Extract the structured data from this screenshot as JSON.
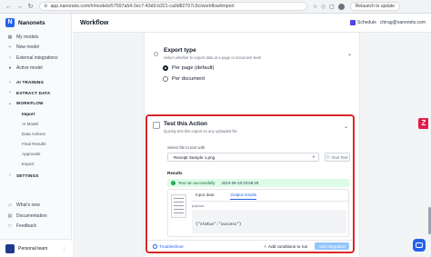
{
  "browser": {
    "url": "app.nanonets.com/#/models/57597a54-2ec7-43d3-b321-ca0d82707c3c/workflow/import",
    "relaunch_label": "Relaunch to update"
  },
  "sidebar": {
    "brand": "Nanonets",
    "items": [
      {
        "label": "My models",
        "icon": "grid-icon"
      },
      {
        "label": "New model",
        "icon": "plus-icon"
      },
      {
        "label": "External integrations",
        "icon": "plug-icon"
      },
      {
        "label": "Active model",
        "icon": "circle-icon"
      }
    ],
    "sections": {
      "ai_training": "AI TRAINING",
      "extract_data": "EXTRACT DATA",
      "workflow": "WORKFLOW",
      "settings": "SETTINGS"
    },
    "workflow_items": [
      "Import",
      "AI Model",
      "Data Actions",
      "Final Results",
      "Approvals",
      "Export"
    ],
    "active_workflow_item": "Import",
    "bottom_items": [
      {
        "label": "What's new",
        "icon": "gift-icon"
      },
      {
        "label": "Documentation",
        "icon": "book-icon"
      },
      {
        "label": "Feedback",
        "icon": "chat-icon"
      }
    ],
    "team": "Personal team"
  },
  "topbar": {
    "title": "Workflow",
    "schedule_label": "Schedule",
    "email": "chirag@nanonets.com"
  },
  "export_type": {
    "title": "Export type",
    "subtitle": "Select whether to export data at a page or document level",
    "options": [
      "Per page (default)",
      "Per document"
    ],
    "selected": "Per page (default)"
  },
  "test_action": {
    "title": "Test this Action",
    "subtitle": "Quickly test this export on any uploaded file",
    "file_label": "Select file to test with",
    "file_value": "Receipt Sample 1.png",
    "run_label": "Run Test",
    "results_label": "Results",
    "status_text": "Test ran successfully",
    "timestamp": "2024-06-19 03:58:29",
    "tabs": [
      "Input data",
      "Output results"
    ],
    "active_tab": "Output results",
    "payload_label": "payload",
    "payload": "{\"status\":\"success\"}",
    "troubleshoot_label": "Troubleshoot",
    "add_conditions_label": "Add conditions to run",
    "add_integration_label": "Add Integration"
  }
}
